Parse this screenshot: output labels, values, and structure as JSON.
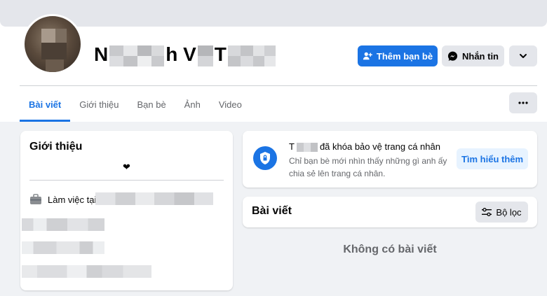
{
  "profile": {
    "name_parts": [
      "N",
      "h V",
      "T"
    ],
    "add_friend_label": "Thêm bạn bè",
    "message_label": "Nhắn tin"
  },
  "tabs": [
    {
      "label": "Bài viết",
      "active": true
    },
    {
      "label": "Giới thiệu",
      "active": false
    },
    {
      "label": "Bạn bè",
      "active": false
    },
    {
      "label": "Ảnh",
      "active": false
    },
    {
      "label": "Video",
      "active": false
    }
  ],
  "intro": {
    "title": "Giới thiệu",
    "bio": "❤",
    "work_prefix": "Làm việc tại"
  },
  "lock_notice": {
    "name_initial": "T",
    "title_rest": "đã khóa bảo vệ trang cá nhân",
    "description": "Chỉ bạn bè mới nhìn thấy những gì anh ấy chia sẻ lên trang cá nhân.",
    "learn_more_label": "Tìm hiểu thêm"
  },
  "posts": {
    "title": "Bài viết",
    "filter_label": "Bộ lọc",
    "empty_message": "Không có bài viết"
  },
  "colors": {
    "primary": "#1b74e4",
    "background": "#f0f2f5",
    "secondary_button": "#e4e6eb",
    "muted_text": "#65676b"
  },
  "icons": {
    "add_friend": "person-plus-icon",
    "message": "messenger-icon",
    "chevron": "chevron-down-icon",
    "more": "more-horizontal-icon",
    "work": "briefcase-icon",
    "shield": "shield-lock-icon",
    "filter": "sliders-icon"
  }
}
